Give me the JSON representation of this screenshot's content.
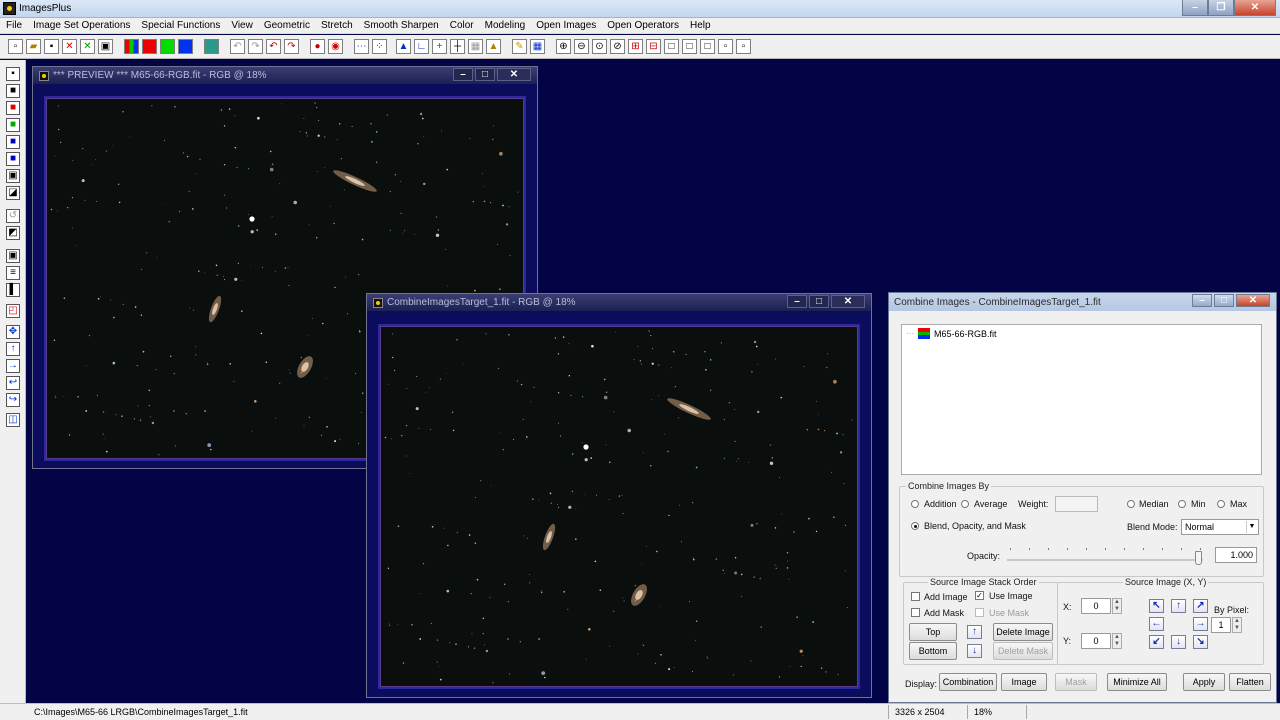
{
  "app": {
    "title": "ImagesPlus"
  },
  "menu": [
    "File",
    "Image Set Operations",
    "Special Functions",
    "View",
    "Geometric",
    "Stretch",
    "Smooth Sharpen",
    "Color",
    "Modeling",
    "Open Images",
    "Open Operators",
    "Help"
  ],
  "preview_window": {
    "title": "*** PREVIEW *** M65-66-RGB.fit - RGB @ 18%"
  },
  "target_window": {
    "title": "CombineImagesTarget_1.fit - RGB @ 18%"
  },
  "dialog": {
    "title": "Combine Images - CombineImagesTarget_1.fit",
    "tree_item": "M65-66-RGB.fit",
    "combine_by": {
      "legend": "Combine Images By",
      "addition": "Addition",
      "average": "Average",
      "weight_label": "Weight:",
      "weight_value": "",
      "median": "Median",
      "min": "Min",
      "max": "Max",
      "blend": "Blend, Opacity, and Mask",
      "blend_mode_label": "Blend Mode:",
      "blend_mode": "Normal",
      "opacity_label": "Opacity:",
      "opacity": "1.000",
      "opacity_level": 1.0
    },
    "stack": {
      "legend": "Source Image Stack Order",
      "add_image": "Add Image",
      "use_image": "Use Image",
      "add_mask": "Add Mask",
      "use_mask": "Use Mask",
      "top": "Top",
      "bottom": "Bottom",
      "delete_image": "Delete Image",
      "delete_mask": "Delete Mask"
    },
    "source_xy": {
      "legend": "Source Image (X, Y)",
      "x_label": "X:",
      "x_value": "0",
      "y_label": "Y:",
      "y_value": "0",
      "by_pixel_label": "By Pixel:",
      "by_pixel_value": "1"
    },
    "display": {
      "label": "Display:",
      "combination": "Combination",
      "image": "Image",
      "mask": "Mask",
      "minimize_all": "Minimize All",
      "apply": "Apply",
      "flatten": "Flatten"
    }
  },
  "status": {
    "path": "C:\\Images\\M65-66 LRGB\\CombineImagesTarget_1.fit",
    "dims": "3326 x 2504",
    "zoom": "18%"
  },
  "colors": {
    "desktop": "#030445",
    "window_frame": "#0b0c5c",
    "accent_red": "#e00000",
    "accent_green": "#00c000",
    "accent_blue": "#0030e0"
  }
}
